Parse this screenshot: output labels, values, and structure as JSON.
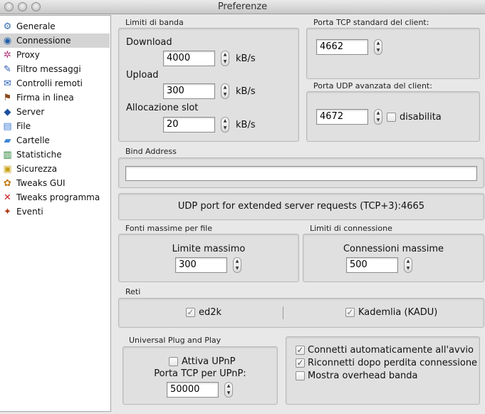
{
  "window": {
    "title": "Preferenze"
  },
  "sidebar": {
    "items": [
      {
        "label": "Generale",
        "icon": "generale-icon"
      },
      {
        "label": "Connessione",
        "icon": "connessione-icon",
        "selected": true
      },
      {
        "label": "Proxy",
        "icon": "proxy-icon"
      },
      {
        "label": "Filtro messaggi",
        "icon": "filtro-messaggi-icon"
      },
      {
        "label": "Controlli remoti",
        "icon": "controlli-remoti-icon"
      },
      {
        "label": "Firma in linea",
        "icon": "firma-in-linea-icon"
      },
      {
        "label": "Server",
        "icon": "server-icon"
      },
      {
        "label": "File",
        "icon": "file-icon"
      },
      {
        "label": "Cartelle",
        "icon": "folder-icon"
      },
      {
        "label": "Statistiche",
        "icon": "statistiche-icon"
      },
      {
        "label": "Sicurezza",
        "icon": "lock-icon"
      },
      {
        "label": "Tweaks GUI",
        "icon": "tweaks-gui-icon"
      },
      {
        "label": "Tweaks programma",
        "icon": "tweaks-programma-icon"
      },
      {
        "label": "Eventi",
        "icon": "eventi-icon"
      }
    ]
  },
  "bandwidth": {
    "group_label": "Limiti di banda",
    "download_label": "Download",
    "download_value": "4000",
    "upload_label": "Upload",
    "upload_value": "300",
    "slot_label": "Allocazione slot",
    "slot_value": "20",
    "unit": "kB/s"
  },
  "tcp_port": {
    "group_label": "Porta TCP standard del client:",
    "value": "4662"
  },
  "udp_port": {
    "group_label": "Porta UDP avanzata del client:",
    "value": "4672",
    "disable_label": "disabilita",
    "disabled": false
  },
  "bind_address": {
    "group_label": "Bind Address",
    "value": ""
  },
  "udp_extended": {
    "text": "UDP port for extended server requests (TCP+3):4665"
  },
  "max_sources": {
    "group_label": "Fonti massime per file",
    "label": "Limite massimo",
    "value": "300"
  },
  "conn_limits": {
    "group_label": "Limiti di connessione",
    "label": "Connessioni massime",
    "value": "500"
  },
  "networks": {
    "group_label": "Reti",
    "ed2k_label": "ed2k",
    "ed2k_checked": true,
    "kad_label": "Kademlia (KADU)",
    "kad_checked": true
  },
  "upnp": {
    "group_label": "Universal Plug and Play",
    "enable_label": "Attiva UPnP",
    "enable_checked": false,
    "port_label": "Porta TCP per UPnP:",
    "port_value": "50000"
  },
  "options": {
    "autoconnect_label": "Connetti automaticamente all'avvio",
    "autoconnect_checked": true,
    "reconnect_label": "Riconnetti dopo perdita connessione",
    "reconnect_checked": true,
    "overhead_label": "Mostra overhead banda",
    "overhead_checked": false
  },
  "glyphs": {
    "check": "✓",
    "up": "▲",
    "down": "▼"
  }
}
